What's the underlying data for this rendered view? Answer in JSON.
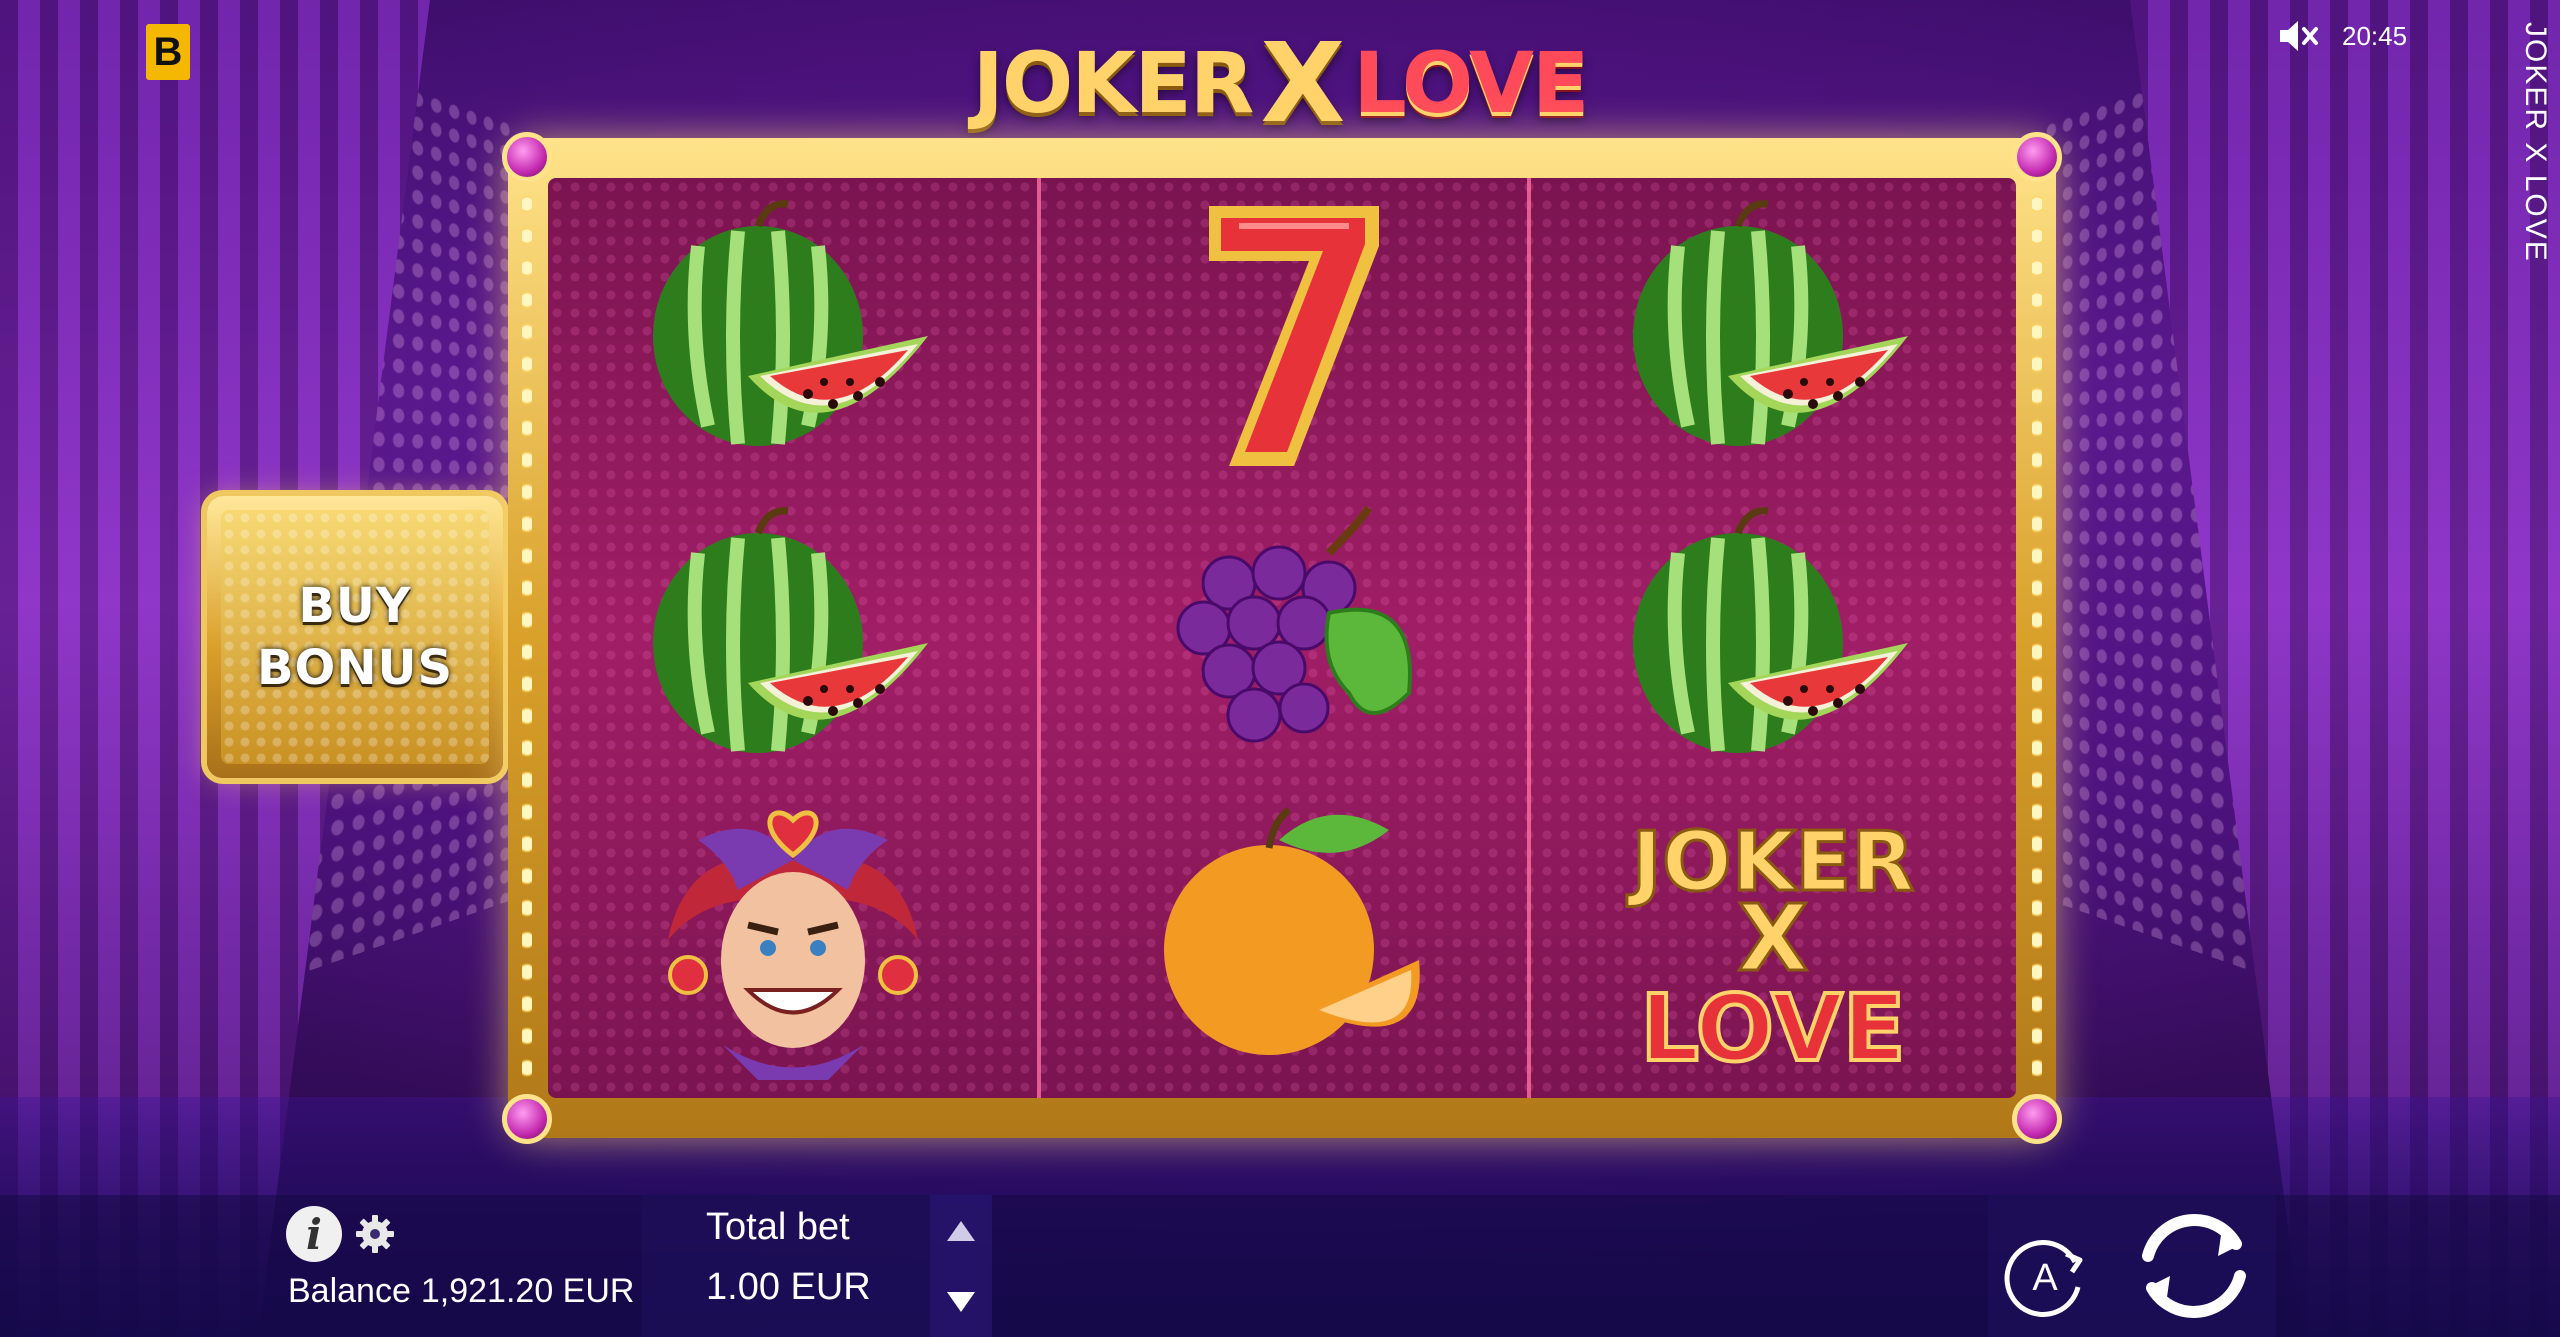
{
  "app": {
    "title": "JOKER X LOVE",
    "brand_badge": "B"
  },
  "status": {
    "sound_icon": "speaker-muted-icon",
    "time": "20:45"
  },
  "logo": {
    "word1": "JOKER",
    "x": "X",
    "word2": "LOVE"
  },
  "buy_bonus": {
    "line1": "BUY",
    "line2": "BONUS"
  },
  "reels": [
    [
      "watermelon",
      "watermelon",
      "joker"
    ],
    [
      "seven",
      "grapes",
      "orange"
    ],
    [
      "watermelon",
      "watermelon",
      "joker-x-love-logo"
    ]
  ],
  "reel_logo_symbol": {
    "word1": "JOKER",
    "x": "X",
    "word2": "LOVE"
  },
  "controls": {
    "info_icon": "info-icon",
    "settings_icon": "gear-icon",
    "balance_label": "Balance",
    "balance_value": "1,921.20 EUR",
    "bet_label": "Total bet",
    "bet_value": "1.00 EUR",
    "autoplay_label": "A",
    "spin_icon": "spin-arrows-icon"
  },
  "colors": {
    "brand_badge": "#f5b800",
    "frame_gold": "#d9a02a",
    "reel_bg": "#a01e66",
    "logo_red": "#ff4a5a",
    "logo_gold": "#ffd36a"
  }
}
